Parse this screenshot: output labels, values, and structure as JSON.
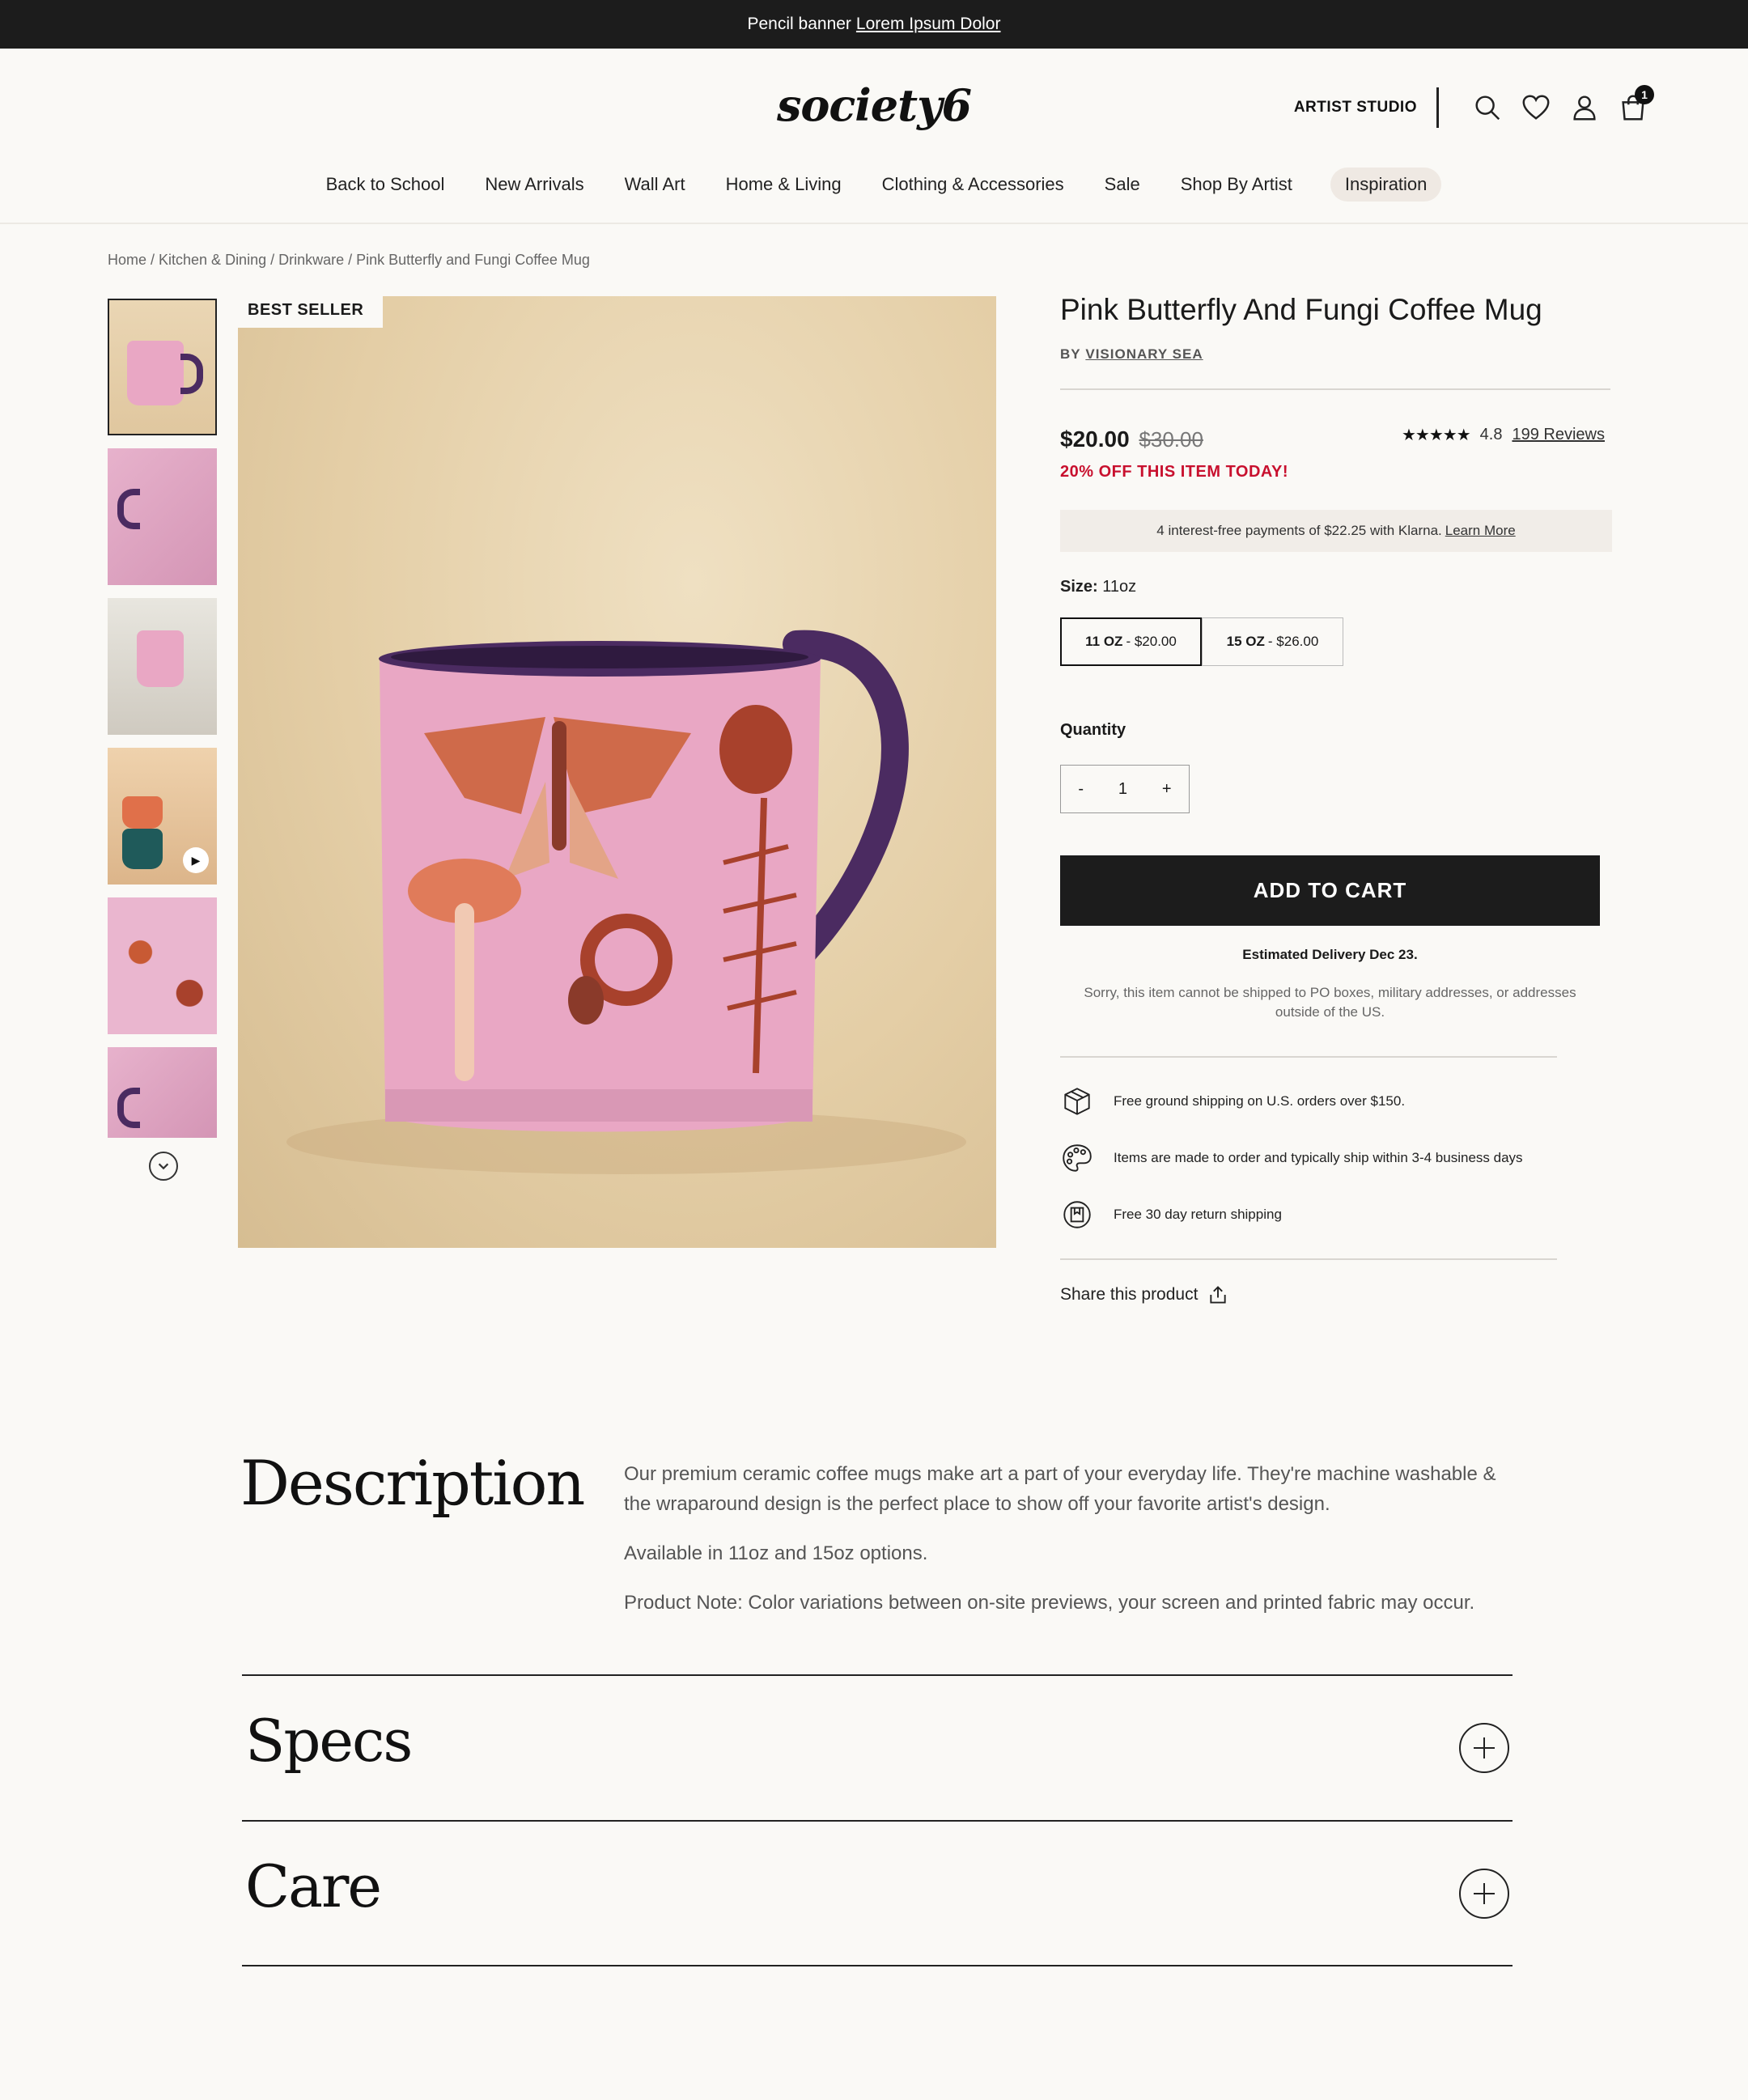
{
  "banner": {
    "text": "Pencil banner",
    "link": "Lorem Ipsum Dolor"
  },
  "header": {
    "logo": "society6",
    "artist_studio": "ARTIST STUDIO",
    "cart_count": "1",
    "icons": [
      "search-icon",
      "heart-icon",
      "user-icon",
      "cart-icon"
    ]
  },
  "nav": [
    "Back to School",
    "New Arrivals",
    "Wall Art",
    "Home & Living",
    "Clothing & Accessories",
    "Sale",
    "Shop By Artist",
    "Inspiration"
  ],
  "breadcrumb": "Home / Kitchen & Dining / Drinkware / Pink Butterfly and Fungi Coffee Mug",
  "gallery": {
    "badge": "BEST SELLER"
  },
  "product": {
    "title": "Pink Butterfly And Fungi Coffee Mug",
    "by_prefix": "BY",
    "artist": "VISIONARY SEA",
    "price": "$20.00",
    "old_price": "$30.00",
    "discount": "20% OFF THIS ITEM TODAY!",
    "stars": "★★★★★",
    "rating": "4.8",
    "reviews": "199 Reviews",
    "klarna_text": "4 interest-free payments of $22.25 with Klarna.",
    "klarna_link": "Learn More",
    "size_label": "Size:",
    "size_value": "11oz",
    "sizes": [
      {
        "name": "11 OZ",
        "price": "- $20.00"
      },
      {
        "name": "15 OZ",
        "price": "- $26.00"
      }
    ],
    "quantity_label": "Quantity",
    "qty_minus": "-",
    "qty_value": "1",
    "qty_plus": "+",
    "add_to_cart": "ADD TO CART",
    "delivery": "Estimated Delivery Dec 23.",
    "ship_note": "Sorry, this item cannot be shipped to PO boxes, military addresses, or addresses outside of the US.",
    "features": [
      "Free ground  shipping on U.S. orders over $150.",
      "Items are made to order and typically ship within 3-4 business days",
      "Free 30 day return shipping"
    ],
    "share": "Share this product"
  },
  "description": {
    "title": "Description",
    "p1": "Our premium ceramic coffee mugs make art a part of your everyday life. They're machine washable & the wraparound design is the perfect place to show off your favorite artist's design.",
    "p2": "Available in 11oz and 15oz options.",
    "p3": "Product Note:  Color variations between on-site previews, your screen and printed fabric may occur."
  },
  "accordions": {
    "specs": "Specs",
    "care": "Care"
  },
  "colors": {
    "accent_red": "#c8102e",
    "dark": "#1c1c1c",
    "mug_pink": "#e9a7c4",
    "mug_purple": "#4b2b61"
  }
}
